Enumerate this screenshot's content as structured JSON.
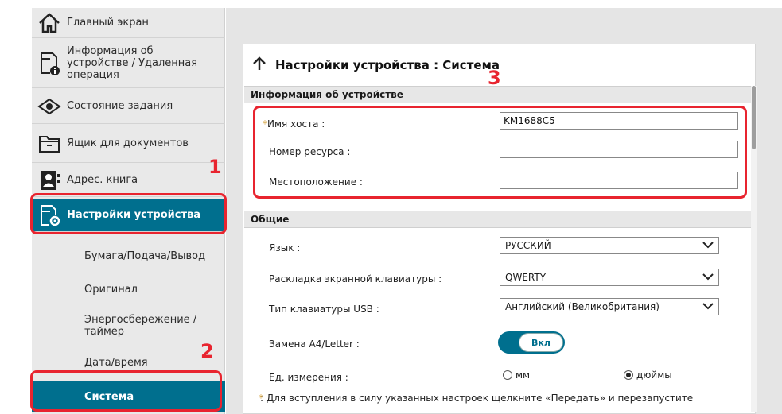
{
  "sidebar": {
    "items": [
      {
        "label": "Главный экран",
        "icon": "home-icon"
      },
      {
        "label": "Информация об устройстве / Удаленная операция",
        "icon": "device-info-icon"
      },
      {
        "label": "Состояние задания",
        "icon": "eye-icon"
      },
      {
        "label": "Ящик для документов",
        "icon": "document-box-icon"
      },
      {
        "label": "Адрес. книга",
        "icon": "address-book-icon"
      },
      {
        "label": "Настройки устройства",
        "icon": "device-settings-icon",
        "active": true
      }
    ],
    "subitems": [
      {
        "label": "Бумага/Подача/Вывод"
      },
      {
        "label": "Оригинал"
      },
      {
        "label": "Энергосбережение / таймер"
      },
      {
        "label": "Дата/время"
      },
      {
        "label": "Система",
        "active": true
      }
    ]
  },
  "main": {
    "title": "Настройки устройства : Система",
    "device_info": {
      "header": "Информация об устройстве",
      "hostname_label": "Имя хоста :",
      "hostname_value": "KM1688C5",
      "asset_label": "Номер ресурса :",
      "asset_value": "",
      "location_label": "Местоположение :",
      "location_value": ""
    },
    "general": {
      "header": "Общие",
      "language_label": "Язык :",
      "language_value": "РУССКИЙ",
      "keyboard_layout_label": "Раскладка экранной клавиатуры :",
      "keyboard_layout_value": "QWERTY",
      "usb_keyboard_label": "Тип клавиатуры USB :",
      "usb_keyboard_value": "Английский (Великобритания)",
      "a4_letter_label": "Замена A4/Letter :",
      "a4_letter_toggle": "Вкл",
      "units_label": "Ед. измерения :",
      "units_mm": "мм",
      "units_inches": "дюймы",
      "units_selected": "дюймы"
    },
    "footnote_marker": "*",
    "footnote": ": Для вступления в силу указанных настроек щелкните «Передать» и перезапустите"
  },
  "annotations": {
    "one": "1",
    "two": "2",
    "three": "3"
  },
  "colors": {
    "accent": "#006f8e",
    "annotation": "#e8242f",
    "required": "#d4a13b"
  }
}
